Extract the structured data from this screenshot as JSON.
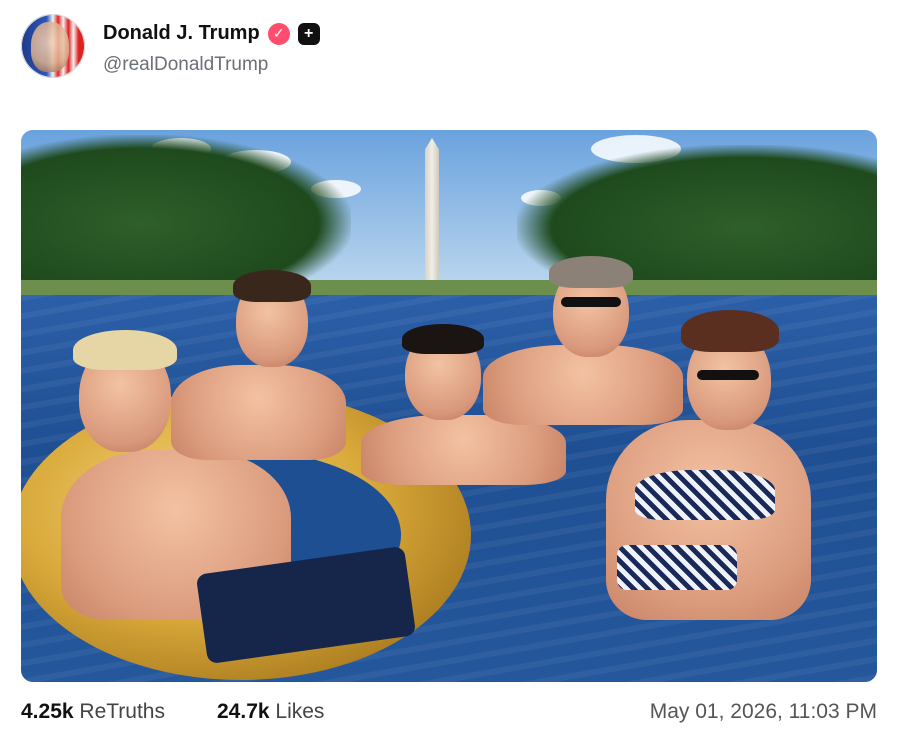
{
  "post": {
    "author_name": "Donald J. Trump",
    "handle": "@realDonaldTrump",
    "verified_badge_icon": "verified-check-icon",
    "plus_badge_icon": "plus-badge-icon"
  },
  "media": {
    "kind": "photo",
    "accent_colors": {
      "water": "#1f4f93",
      "float": "#d9a93a",
      "shorts": "#16254a"
    }
  },
  "stats": {
    "retruths_count": "4.25k",
    "retruths_label": "ReTruths",
    "likes_count": "24.7k",
    "likes_label": "Likes",
    "timestamp": "May 01, 2026, 11:03 PM"
  }
}
